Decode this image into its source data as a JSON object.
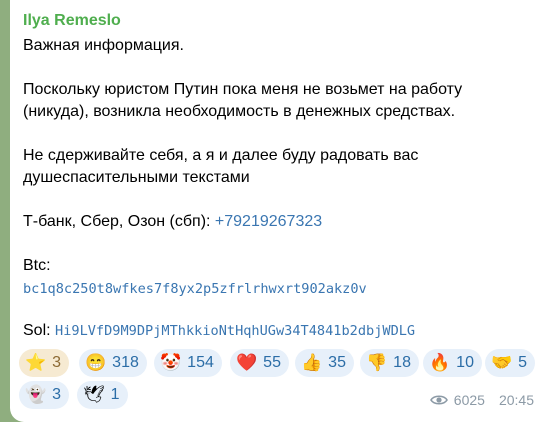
{
  "message": {
    "sender": "Ilya Remeslo",
    "lines": [
      "Важная информация.",
      "Поскольку юристом Путин пока меня не возьмет на работу",
      "(никуда), возникла необходимость в денежных средствах.",
      "Не сдерживайте себя, а я и далее буду радовать вас",
      "душеспасительными текстами",
      "Т-банк, Сбер, Озон (сбп): ",
      "Btc:",
      "Sol: "
    ],
    "phone": "+79219267323",
    "btc_address": "bc1q8c250t8wfkes7f8yx2p5zfrlrhwxrt902akz0v",
    "sol_address": "Hi9LVfD9M9DPjMThkkioNtHqhUGw34T4841b2dbjWDLG"
  },
  "reactions": [
    {
      "emoji": "⭐",
      "count": "3"
    },
    {
      "emoji": "😁",
      "count": "318"
    },
    {
      "emoji": "🤡",
      "count": "154"
    },
    {
      "emoji": "❤️",
      "count": "55"
    },
    {
      "emoji": "👍",
      "count": "35"
    },
    {
      "emoji": "👎",
      "count": "18"
    },
    {
      "emoji": "🔥",
      "count": "10"
    },
    {
      "emoji": "🤝",
      "count": "5"
    },
    {
      "emoji": "👻",
      "count": "3"
    },
    {
      "emoji": "🕊",
      "count": "1"
    }
  ],
  "meta": {
    "views": "6025",
    "time": "20:45",
    "eye_icon": "eye-icon"
  }
}
